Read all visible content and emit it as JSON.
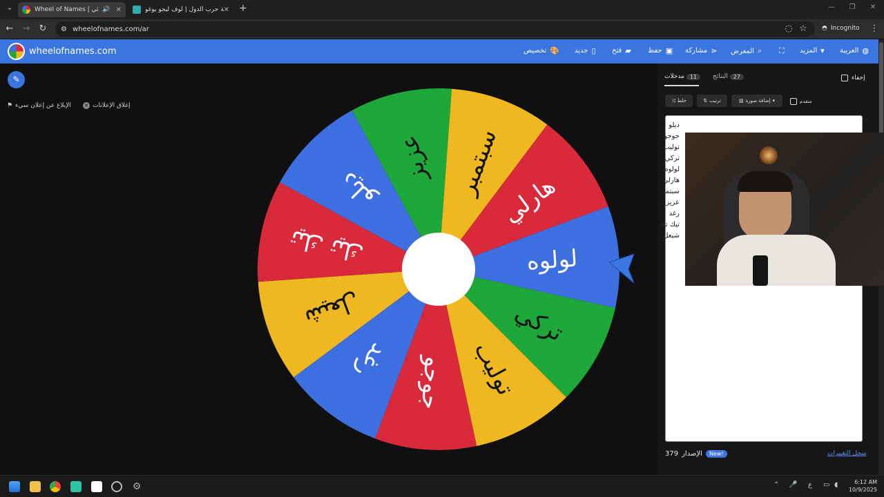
{
  "browser": {
    "tabs": [
      {
        "title": "Wheel of Names | العشوائي",
        "active": true
      },
      {
        "title": "لعبة حرب الدول | لوف ليجو يوغو",
        "active": false
      }
    ],
    "new_tab": "+",
    "url": "wheelofnames.com/ar",
    "incognito_label": "Incognito",
    "window_controls": [
      "—",
      "❐",
      "✕"
    ]
  },
  "app": {
    "logo_text": "wheelofnames.com",
    "menu": {
      "customize": "تخصيص",
      "new": "جديد",
      "open": "فتح",
      "save": "حفظ",
      "share": "مشاركة",
      "gallery": "المعرض",
      "more": "المزيد",
      "language": "العربية"
    }
  },
  "ads": {
    "close_ads": "إغلاق الإعلانات",
    "report_ad": "الإبلاغ عن إعلان سيء"
  },
  "wheel": {
    "segments": [
      {
        "label": "لولوه",
        "color": "#3e6fe0",
        "text_color": "#ffffff"
      },
      {
        "label": "تركي",
        "color": "#1fa83a",
        "text_color": "#111111"
      },
      {
        "label": "توليب",
        "color": "#efb820",
        "text_color": "#111111"
      },
      {
        "label": "جوجو",
        "color": "#d82a3a",
        "text_color": "#ffffff"
      },
      {
        "label": "رغد",
        "color": "#3e6fe0",
        "text_color": "#ffffff"
      },
      {
        "label": "شيعل",
        "color": "#efb820",
        "text_color": "#111111"
      },
      {
        "label": "تيك تيك",
        "color": "#d82a3a",
        "text_color": "#ffffff"
      },
      {
        "label": "ديلو",
        "color": "#3e6fe0",
        "text_color": "#ffffff"
      },
      {
        "label": "عزيز",
        "color": "#1fa83a",
        "text_color": "#111111"
      },
      {
        "label": "سبتمبر",
        "color": "#efb820",
        "text_color": "#111111"
      },
      {
        "label": "هارلي",
        "color": "#d82a3a",
        "text_color": "#ffffff"
      }
    ]
  },
  "sidepanel": {
    "hide_label": "إخفاء",
    "tab_entries": "مدخلات",
    "entries_count": "11",
    "tab_results": "النتائج",
    "results_count": "27",
    "shuffle": "خلط",
    "sort": "ترتيب",
    "add_image": "إضافة صورة",
    "advanced": "متقدم",
    "entries": [
      "ديلو",
      "جوجو",
      "توليب",
      "تركي",
      "لولوه",
      "هارلي",
      "سبتمبر",
      "عزيز",
      "رغد",
      "تيك تيك",
      "شيعل"
    ],
    "version_label": "الإصدار",
    "version": "379",
    "new_badge": "New!",
    "changelog": "سجل التغييرات"
  },
  "taskbar": {
    "time": "6:12 AM",
    "date": "10/9/2025",
    "lang": "ع"
  },
  "colors": {
    "brand_blue": "#3b76e0",
    "red": "#d82a3a",
    "green": "#1fa83a",
    "yellow": "#efb820",
    "blue": "#3e6fe0"
  }
}
